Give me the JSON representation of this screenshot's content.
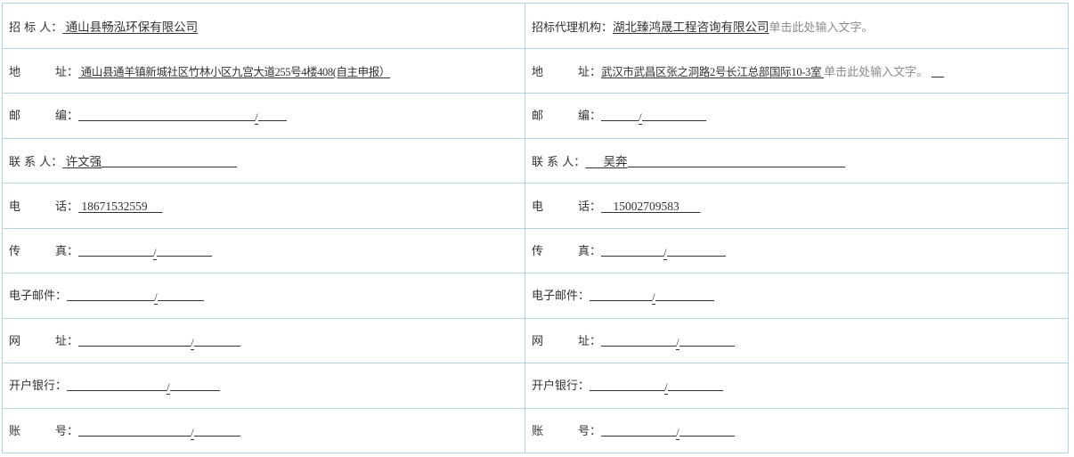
{
  "rows": [
    {
      "l_label": "招 标 人：",
      "l_value": " 通山县畅泓环保有限公司",
      "l_hint": "",
      "r_label": "招标代理机构：",
      "r_value": "湖北臻鸿晟工程咨询有限公司",
      "r_hint": "单击此处输入文字。"
    },
    {
      "l_label": "地　　　址：",
      "l_value": " 通山县通羊镇新城社区竹林小区九宫大道255号4楼408(自主申报）",
      "l_hint": "",
      "r_label": "地　　　址：",
      "r_value": "武汉市武昌区张之洞路2号长江总部国际10-3室 ",
      "r_hint": "单击此处输入文字。"
    },
    {
      "l_label": "邮　　　编：",
      "l_value": "",
      "l_hint": "",
      "r_label": "邮　　　编：",
      "r_value": "",
      "r_hint": ""
    },
    {
      "l_label": "联 系 人：",
      "l_value": " 许文强",
      "l_hint": "",
      "r_label": "联 系 人：",
      "r_value": "      吴奔",
      "r_hint": ""
    },
    {
      "l_label": "电　　　话：",
      "l_value": " 18671532559     ",
      "l_hint": "",
      "r_label": "电　　　话：",
      "r_value": "    15002709583       ",
      "r_hint": ""
    },
    {
      "l_label": "传　　　真：",
      "l_value": "",
      "l_hint": "",
      "r_label": "传　　　真：",
      "r_value": "",
      "r_hint": ""
    },
    {
      "l_label": "电子邮件：",
      "l_value": "",
      "l_hint": "",
      "r_label": "电子邮件：",
      "r_value": "",
      "r_hint": ""
    },
    {
      "l_label": "网　　　址：",
      "l_value": "",
      "l_hint": "",
      "r_label": "网　　　址：",
      "r_value": "",
      "r_hint": ""
    },
    {
      "l_label": "开户银行：",
      "l_value": "",
      "l_hint": "",
      "r_label": "开户银行：",
      "r_value": "",
      "r_hint": ""
    },
    {
      "l_label": "账　　　号：",
      "l_value": "",
      "l_hint": "",
      "r_label": "账　　　号：",
      "r_value": "",
      "r_hint": ""
    }
  ],
  "slash": "/"
}
